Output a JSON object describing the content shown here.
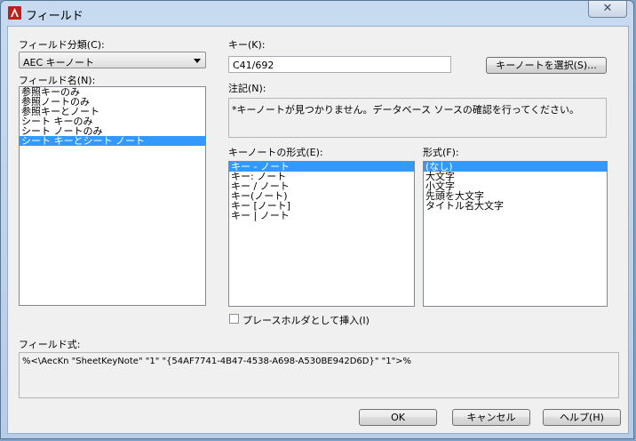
{
  "window": {
    "title": "フィールド",
    "close_glyph": "✕"
  },
  "field_category": {
    "label": "フィールド分類(C):",
    "value": "AEC キーノート"
  },
  "field_names": {
    "label": "フィールド名(N):",
    "items": [
      "参照キーのみ",
      "参照ノートのみ",
      "参照キーとノート",
      "シート キーのみ",
      "シート ノートのみ",
      "シート キーとシート ノート"
    ],
    "selected_index": 5
  },
  "key": {
    "label": "キー(K):",
    "value": "C41/692"
  },
  "select_keynote_button": "キーノートを選択(S)...",
  "note": {
    "label": "注記(N):",
    "value": "*キーノートが見つかりません。データベース ソースの確認を行ってください。"
  },
  "keynote_format": {
    "label": "キーノートの形式(E):",
    "items": [
      "キー - ノート",
      "キー: ノート",
      "キー / ノート",
      "キー(ノート)",
      "キー [ノート]",
      "キー | ノート"
    ],
    "selected_index": 0
  },
  "format": {
    "label": "形式(F):",
    "items": [
      "(なし)",
      "大文字",
      "小文字",
      "先頭を大文字",
      "タイトル名大文字"
    ],
    "selected_index": 0
  },
  "placeholder_checkbox": {
    "label": "プレースホルダとして挿入(I)",
    "checked": false
  },
  "field_expression": {
    "label": "フィールド式:",
    "value": "%<\\AecKn \"SheetKeyNote\" \"1\" \"{54AF7741-4B47-4538-A698-A530BE942D6D}\" \"1\">%"
  },
  "buttons": {
    "ok": "OK",
    "cancel": "キャンセル",
    "help": "ヘルプ(H)"
  },
  "colors": {
    "selection": "#3399ff",
    "window_frame": "#b6cce7",
    "app_icon": "#c0201a"
  }
}
